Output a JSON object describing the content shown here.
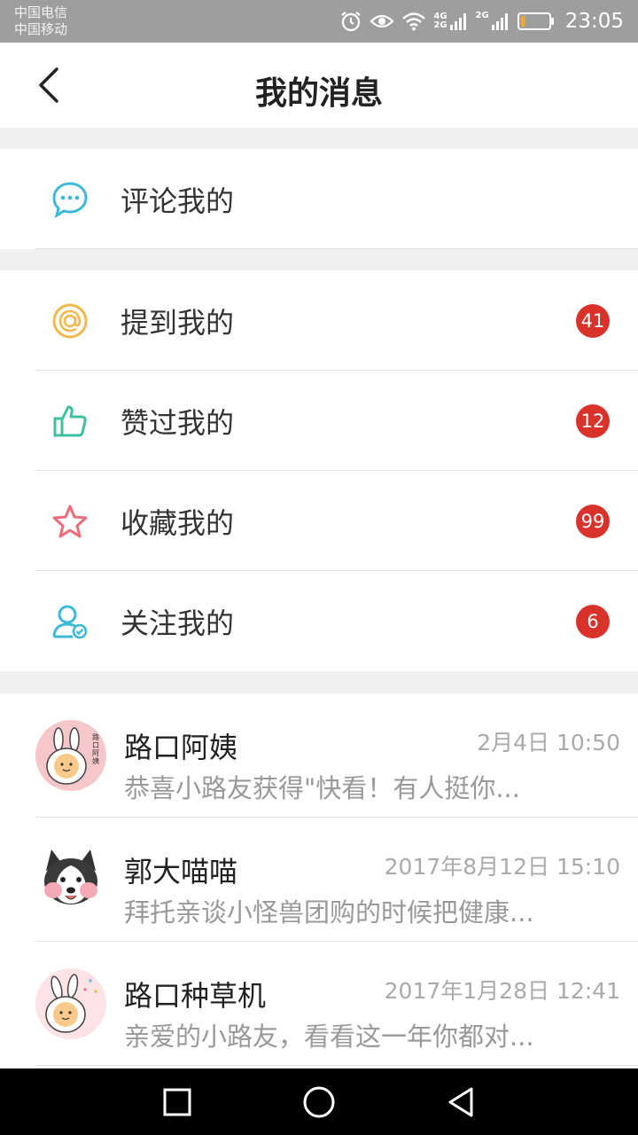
{
  "status_bar": {
    "carrier_1": "中国电信",
    "carrier_2": "中国移动",
    "net_1": "4G",
    "net_2": "2G",
    "net_3": "2G",
    "time": "23:05",
    "battery_level": 0.15
  },
  "header": {
    "title": "我的消息",
    "back_icon": "chevron-left-icon"
  },
  "menu": {
    "comments": {
      "label": "评论我的",
      "icon": "chat-bubble-icon",
      "color": "#3cb9d8"
    },
    "mentions": {
      "label": "提到我的",
      "icon": "at-icon",
      "color": "#f2b84b",
      "badge": "41"
    },
    "likes": {
      "label": "赞过我的",
      "icon": "thumbs-up-icon",
      "color": "#3ec0a0",
      "badge": "12"
    },
    "favorites": {
      "label": "收藏我的",
      "icon": "star-icon",
      "color": "#ee6b7a",
      "badge": "99"
    },
    "follows": {
      "label": "关注我的",
      "icon": "user-check-icon",
      "color": "#3cb9d8",
      "badge": "6"
    }
  },
  "messages": [
    {
      "name": "路口阿姨",
      "time": "2月4日 10:50",
      "preview": "恭喜小路友获得\"快看！有人挺你..."
    },
    {
      "name": "郭大喵喵",
      "time": "2017年8月12日 15:10",
      "preview": "拜托亲谈小怪兽团购的时候把健康..."
    },
    {
      "name": "路口种草机",
      "time": "2017年1月28日 12:41",
      "preview": "亲爱的小路友，看看这一年你都对..."
    }
  ],
  "avatar_badge_text": "路口阿姨",
  "colors": {
    "badge": "#d8322b",
    "status_bar": "#9e9e9e"
  }
}
